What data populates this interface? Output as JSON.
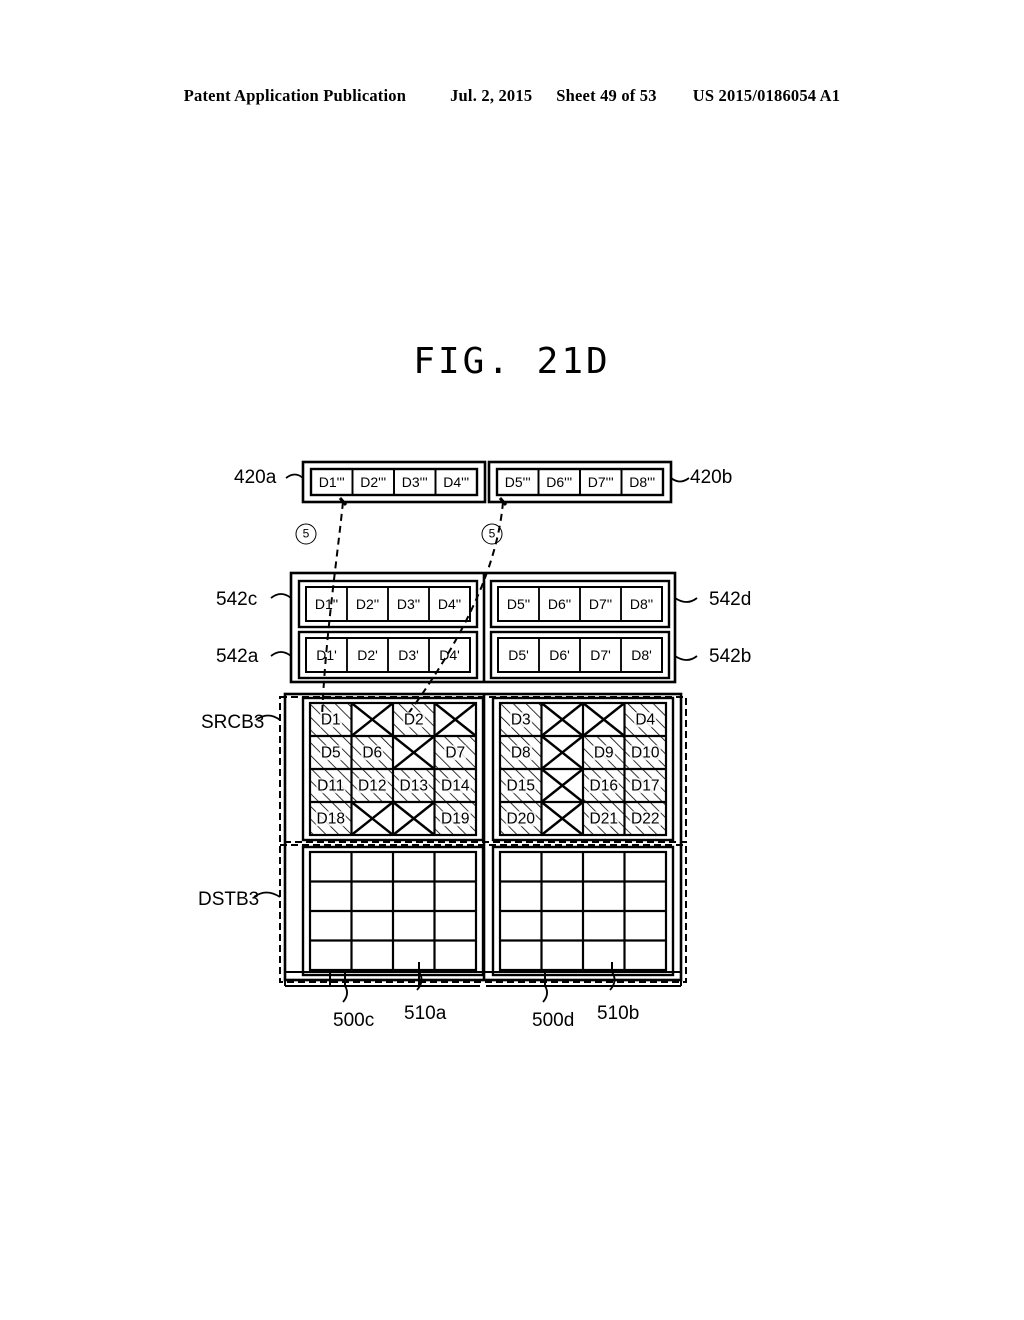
{
  "header": {
    "publication": "Patent Application Publication",
    "date": "Jul. 2, 2015",
    "sheet": "Sheet 49 of 53",
    "number": "US 2015/0186054 A1"
  },
  "figure": {
    "title": "FIG. 21D"
  },
  "reference_labels": {
    "top_left": "420a",
    "top_right": "420b",
    "mid_upper_left": "542c",
    "mid_upper_right": "542d",
    "mid_lower_left": "542a",
    "mid_lower_right": "542b",
    "region_upper": "SRCB3",
    "region_lower": "DSTB3",
    "bottom_1": "500c",
    "bottom_2": "510a",
    "bottom_3": "500d",
    "bottom_4": "510b"
  },
  "callouts": [
    {
      "name": "callout-left",
      "text": "5"
    },
    {
      "name": "callout-right",
      "text": "5"
    }
  ],
  "buffers": {
    "row_420a": [
      "D1'''",
      "D2'''",
      "D3'''",
      "D4'''"
    ],
    "row_420b": [
      "D5'''",
      "D6'''",
      "D7'''",
      "D8'''"
    ],
    "row_542c": [
      "D1''",
      "D2''",
      "D3''",
      "D4''"
    ],
    "row_542d": [
      "D5''",
      "D6''",
      "D7''",
      "D8''"
    ],
    "row_542a": [
      "D1'",
      "D2'",
      "D3'",
      "D4'"
    ],
    "row_542b": [
      "D5'",
      "D6'",
      "D7'",
      "D8'"
    ]
  },
  "grid_left": {
    "name": "500c / 510a",
    "rows": [
      [
        {
          "label": "D1",
          "state": "hatched"
        },
        {
          "label": "",
          "state": "crossed"
        },
        {
          "label": "D2",
          "state": "hatched"
        },
        {
          "label": "",
          "state": "crossed"
        }
      ],
      [
        {
          "label": "D5",
          "state": "hatched"
        },
        {
          "label": "D6",
          "state": "hatched"
        },
        {
          "label": "",
          "state": "crossed"
        },
        {
          "label": "D7",
          "state": "hatched"
        }
      ],
      [
        {
          "label": "D11",
          "state": "hatched"
        },
        {
          "label": "D12",
          "state": "hatched"
        },
        {
          "label": "D13",
          "state": "hatched"
        },
        {
          "label": "D14",
          "state": "hatched"
        }
      ],
      [
        {
          "label": "D18",
          "state": "hatched"
        },
        {
          "label": "",
          "state": "crossed"
        },
        {
          "label": "",
          "state": "crossed"
        },
        {
          "label": "D19",
          "state": "hatched"
        }
      ]
    ]
  },
  "grid_right": {
    "name": "500d / 510b",
    "rows": [
      [
        {
          "label": "D3",
          "state": "hatched"
        },
        {
          "label": "",
          "state": "crossed"
        },
        {
          "label": "",
          "state": "crossed"
        },
        {
          "label": "D4",
          "state": "hatched"
        }
      ],
      [
        {
          "label": "D8",
          "state": "hatched"
        },
        {
          "label": "",
          "state": "crossed"
        },
        {
          "label": "D9",
          "state": "hatched"
        },
        {
          "label": "D10",
          "state": "hatched"
        }
      ],
      [
        {
          "label": "D15",
          "state": "hatched"
        },
        {
          "label": "",
          "state": "crossed"
        },
        {
          "label": "D16",
          "state": "hatched"
        },
        {
          "label": "D17",
          "state": "hatched"
        }
      ],
      [
        {
          "label": "D20",
          "state": "hatched"
        },
        {
          "label": "",
          "state": "crossed"
        },
        {
          "label": "D21",
          "state": "hatched"
        },
        {
          "label": "D22",
          "state": "hatched"
        }
      ]
    ]
  },
  "grid_lower_left": {
    "rows": 4,
    "cols": 4,
    "state": "empty"
  },
  "grid_lower_right": {
    "rows": 4,
    "cols": 4,
    "state": "empty"
  }
}
